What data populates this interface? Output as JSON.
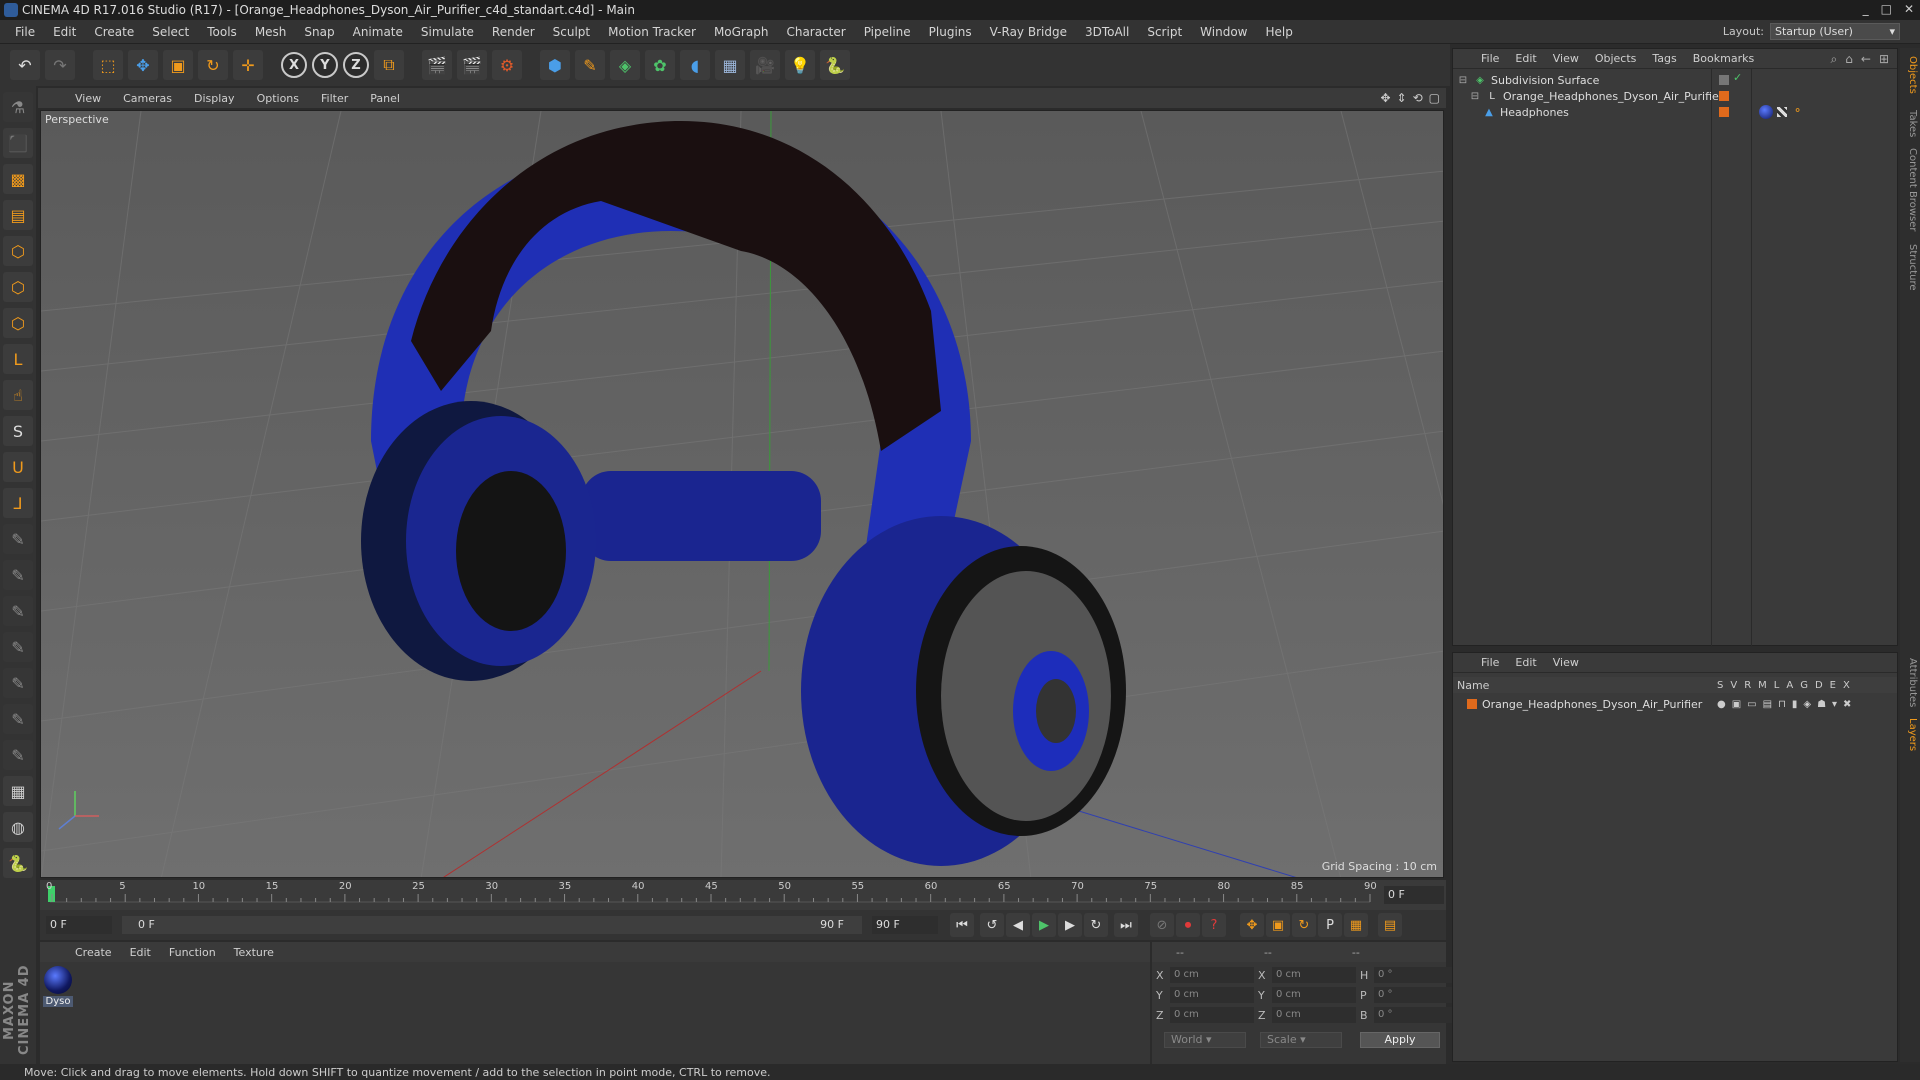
{
  "window": {
    "title": "CINEMA 4D R17.016 Studio (R17) - [Orange_Headphones_Dyson_Air_Purifier_c4d_standart.c4d] - Main",
    "controls": [
      "_",
      "□",
      "✕"
    ]
  },
  "menu": {
    "items": [
      "File",
      "Edit",
      "Create",
      "Select",
      "Tools",
      "Mesh",
      "Snap",
      "Animate",
      "Simulate",
      "Render",
      "Sculpt",
      "Motion Tracker",
      "MoGraph",
      "Character",
      "Pipeline",
      "Plugins",
      "V-Ray Bridge",
      "3DToAll",
      "Script",
      "Window",
      "Help"
    ],
    "layout_label": "Layout:",
    "layout_value": "Startup (User)"
  },
  "toolbar": {
    "axis_x": "X",
    "axis_y": "Y",
    "axis_z": "Z"
  },
  "viewport": {
    "menu": [
      "View",
      "Cameras",
      "Display",
      "Options",
      "Filter",
      "Panel"
    ],
    "label": "Perspective",
    "grid_spacing": "Grid Spacing : 10 cm"
  },
  "timeline": {
    "ticks": [
      "0",
      "5",
      "10",
      "15",
      "20",
      "25",
      "30",
      "35",
      "40",
      "45",
      "50",
      "55",
      "60",
      "65",
      "70",
      "75",
      "80",
      "85",
      "90"
    ],
    "current_frame": "0 F"
  },
  "transport": {
    "start_field": "0 F",
    "range_start": "0 F",
    "range_end": "90 F",
    "end_field": "90 F"
  },
  "material": {
    "menu": [
      "Create",
      "Edit",
      "Function",
      "Texture"
    ],
    "swatch_name": "Dyso"
  },
  "coords": {
    "headers": [
      "--",
      "--",
      "--"
    ],
    "rows": [
      {
        "a": "X",
        "av": "0 cm",
        "b": "X",
        "bv": "0 cm",
        "c": "H",
        "cv": "0 °"
      },
      {
        "a": "Y",
        "av": "0 cm",
        "b": "Y",
        "bv": "0 cm",
        "c": "P",
        "cv": "0 °"
      },
      {
        "a": "Z",
        "av": "0 cm",
        "b": "Z",
        "bv": "0 cm",
        "c": "B",
        "cv": "0 °"
      }
    ],
    "mode": "World",
    "type": "Scale",
    "apply": "Apply"
  },
  "objects": {
    "menu": [
      "File",
      "Edit",
      "View",
      "Objects",
      "Tags",
      "Bookmarks"
    ],
    "items": [
      {
        "name": "Subdivision Surface"
      },
      {
        "name": "Orange_Headphones_Dyson_Air_Purifier"
      },
      {
        "name": "Headphones"
      }
    ]
  },
  "layers": {
    "menu": [
      "File",
      "Edit",
      "View"
    ],
    "col_name": "Name",
    "cols": [
      "S",
      "V",
      "R",
      "M",
      "L",
      "A",
      "G",
      "D",
      "E",
      "X"
    ],
    "row": "Orange_Headphones_Dyson_Air_Purifier",
    "layer_color": "#e06a1c"
  },
  "vtabs": [
    "Objects",
    "Takes",
    "Content Browser",
    "Structure",
    "Attributes",
    "Layers"
  ],
  "status": "Move: Click and drag to move elements. Hold down SHIFT to quantize movement / add to the selection in point mode, CTRL to remove.",
  "colors": {
    "accent_orange": "#f09a1c",
    "headphone_blue": "#1f2fb5"
  },
  "brand": "MAXON CINEMA 4D"
}
